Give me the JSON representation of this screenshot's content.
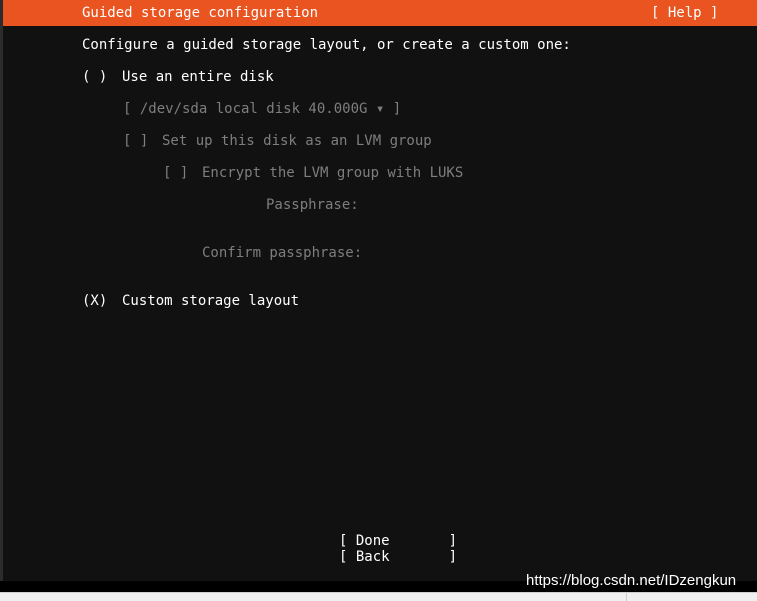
{
  "header": {
    "title": "Guided storage configuration",
    "help_label": "[ Help ]"
  },
  "prompt": "Configure a guided storage layout, or create a custom one:",
  "options": {
    "entire_disk": {
      "radio": "( )",
      "label": "Use an entire disk",
      "disk_select": "[ /dev/sda local disk 40.000G ▾ ]",
      "lvm": {
        "checkbox": "[ ]",
        "label": "Set up this disk as an LVM group"
      },
      "encrypt": {
        "checkbox": "[ ]",
        "label": "Encrypt the LVM group with LUKS"
      },
      "passphrase_label": "Passphrase:",
      "confirm_passphrase_label": "Confirm passphrase:"
    },
    "custom": {
      "radio": "(X)",
      "label": "Custom storage layout"
    }
  },
  "buttons": {
    "done": "[ Done       ]",
    "back": "[ Back       ]"
  },
  "watermark": "https://blog.csdn.net/IDzengkun",
  "colors": {
    "accent": "#e95420",
    "background": "#111111",
    "text": "#ffffff",
    "disabled_text": "#7e7e7e"
  }
}
